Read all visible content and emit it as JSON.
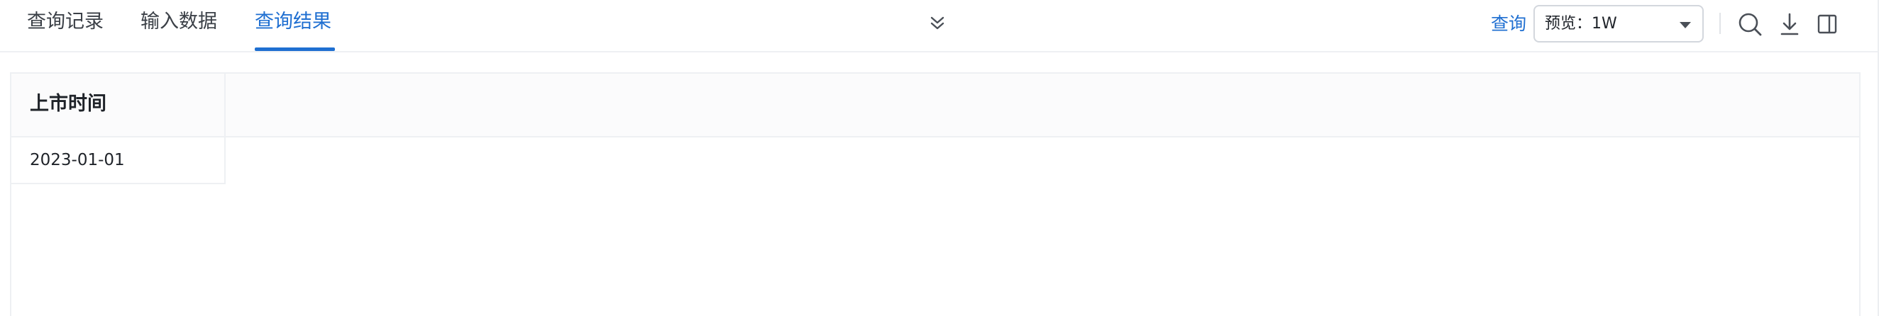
{
  "tabs": [
    {
      "label": "查询记录",
      "active": false
    },
    {
      "label": "输入数据",
      "active": false
    },
    {
      "label": "查询结果",
      "active": true
    }
  ],
  "toolbar": {
    "collapse_icon": "chevrons-down-icon",
    "query_label": "查询",
    "preview_select": {
      "value": "预览：1W"
    },
    "icons": [
      "search-icon",
      "download-icon",
      "sidebar-panel-icon"
    ]
  },
  "table": {
    "columns": [
      "上市时间"
    ],
    "rows": [
      [
        "2023-01-01"
      ]
    ]
  },
  "colors": {
    "accent": "#1f6fd1",
    "text": "#1f2329",
    "border": "#eef0f3"
  }
}
